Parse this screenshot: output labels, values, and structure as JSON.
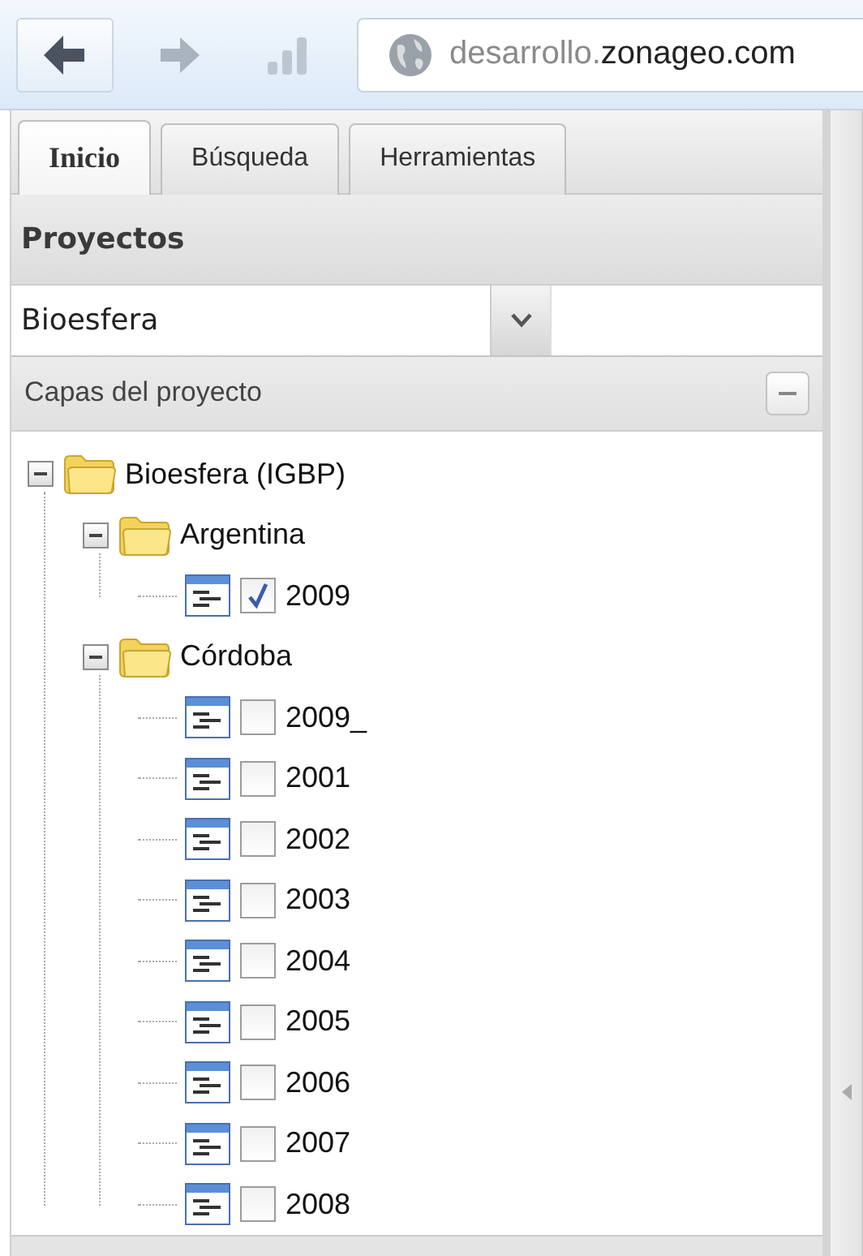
{
  "toolbar": {
    "url_prefix": "desarrollo.",
    "url_domain": "zonageo.com"
  },
  "tabs": [
    {
      "label": "Inicio",
      "selected": true
    },
    {
      "label": "Búsqueda",
      "selected": false
    },
    {
      "label": "Herramientas",
      "selected": false
    }
  ],
  "projects_panel": {
    "title": "Proyectos",
    "project_select": {
      "value": "Bioesfera"
    }
  },
  "layers_panel": {
    "title": "Capas del proyecto",
    "expanded": true
  },
  "tree": [
    {
      "kind": "folder",
      "label": "Bioesfera (IGBP)",
      "expanded": true,
      "children": [
        {
          "kind": "folder",
          "label": "Argentina",
          "expanded": true,
          "children": [
            {
              "kind": "layer",
              "label": "2009",
              "checked": true
            }
          ]
        },
        {
          "kind": "folder",
          "label": "Córdoba",
          "expanded": true,
          "children": [
            {
              "kind": "layer",
              "label": "2009_",
              "checked": false
            },
            {
              "kind": "layer",
              "label": "2001",
              "checked": false
            },
            {
              "kind": "layer",
              "label": "2002",
              "checked": false
            },
            {
              "kind": "layer",
              "label": "2003",
              "checked": false
            },
            {
              "kind": "layer",
              "label": "2004",
              "checked": false
            },
            {
              "kind": "layer",
              "label": "2005",
              "checked": false
            },
            {
              "kind": "layer",
              "label": "2006",
              "checked": false
            },
            {
              "kind": "layer",
              "label": "2007",
              "checked": false
            },
            {
              "kind": "layer",
              "label": "2008",
              "checked": false
            }
          ]
        }
      ]
    }
  ]
}
